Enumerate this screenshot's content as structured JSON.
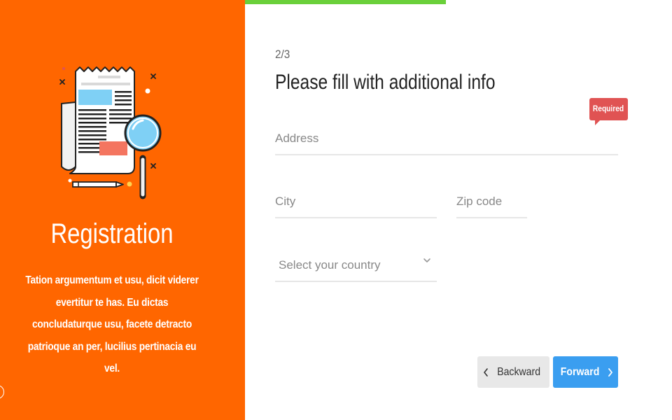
{
  "sidebar": {
    "title": "Registration",
    "description": "Tation argumentum et usu, dicit viderer evertitur te has. Eu dictas concludaturque usu, facete detracto patrioque an per, lucilius pertinacia eu vel.",
    "illustration_icon": "newspaper-magnifier-icon",
    "background_color": "#ff6600"
  },
  "progress": {
    "fraction": 0.47,
    "color": "#6ad03a"
  },
  "form": {
    "step": "2/3",
    "title": "Please fill with additional info",
    "required_badge": "Required",
    "address": {
      "placeholder": "Address",
      "value": ""
    },
    "city": {
      "placeholder": "City",
      "value": ""
    },
    "zip": {
      "placeholder": "Zip code",
      "value": ""
    },
    "country": {
      "selected": "Select your country",
      "options": [
        "Select your country"
      ]
    }
  },
  "buttons": {
    "backward_label": "Backward",
    "forward_label": "Forward",
    "backward_color": "#e8e8e8",
    "forward_color": "#3a9ef0"
  }
}
